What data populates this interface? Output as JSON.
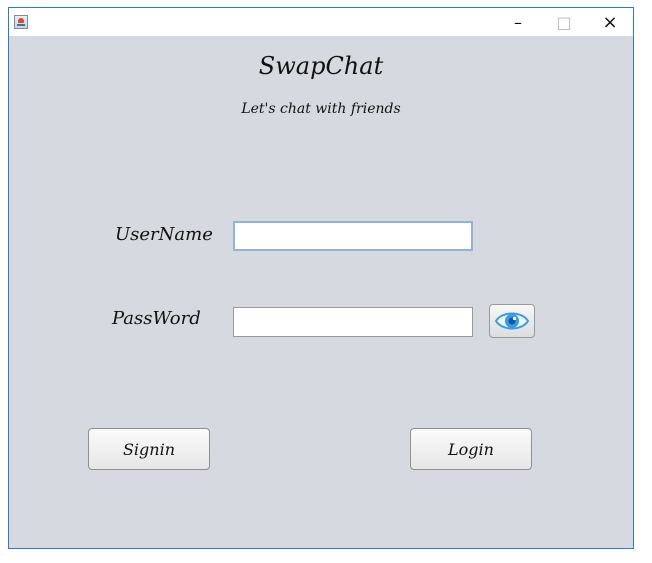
{
  "window": {
    "controls": {
      "minimize": "–",
      "maximize": "□",
      "close": "×"
    }
  },
  "app": {
    "title": "SwapChat",
    "tagline": "Let's chat with friends"
  },
  "form": {
    "username_label": "UserName",
    "username_value": "",
    "password_label": "PassWord",
    "password_value": "",
    "show_password_icon": "eye-icon"
  },
  "buttons": {
    "signin": "Signin",
    "login": "Login"
  },
  "colors": {
    "background": "#d7d9e0",
    "window_border": "#2b7bd1",
    "focus_border": "#8fb3d9"
  }
}
